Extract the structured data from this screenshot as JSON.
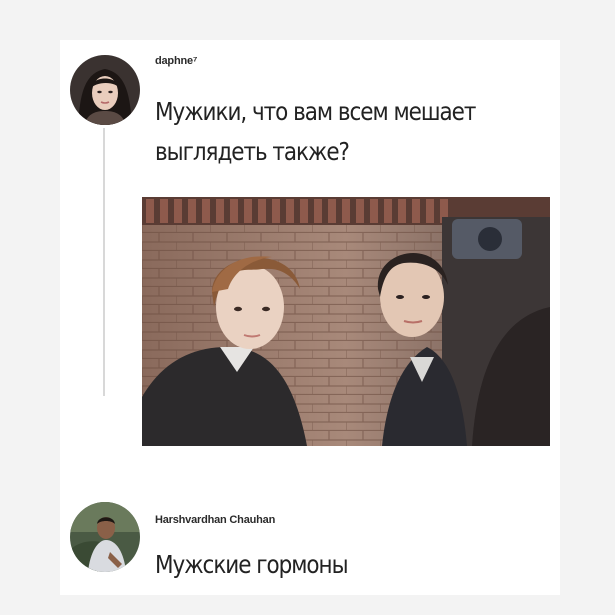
{
  "post": {
    "username": "daphne⁷",
    "text": "Мужики, что вам всем мешает\nвыглядеть также?",
    "avatar": "user-avatar-woman",
    "image": "photo-two-men-by-brick-wall"
  },
  "reply": {
    "username": "Harshvardhan Chauhan",
    "text": "Мужские гормоны",
    "avatar": "user-avatar-man"
  },
  "colors": {
    "background": "#f3f3f3",
    "card": "#ffffff",
    "text": "#222222",
    "thread_line": "#d8d8d8"
  }
}
